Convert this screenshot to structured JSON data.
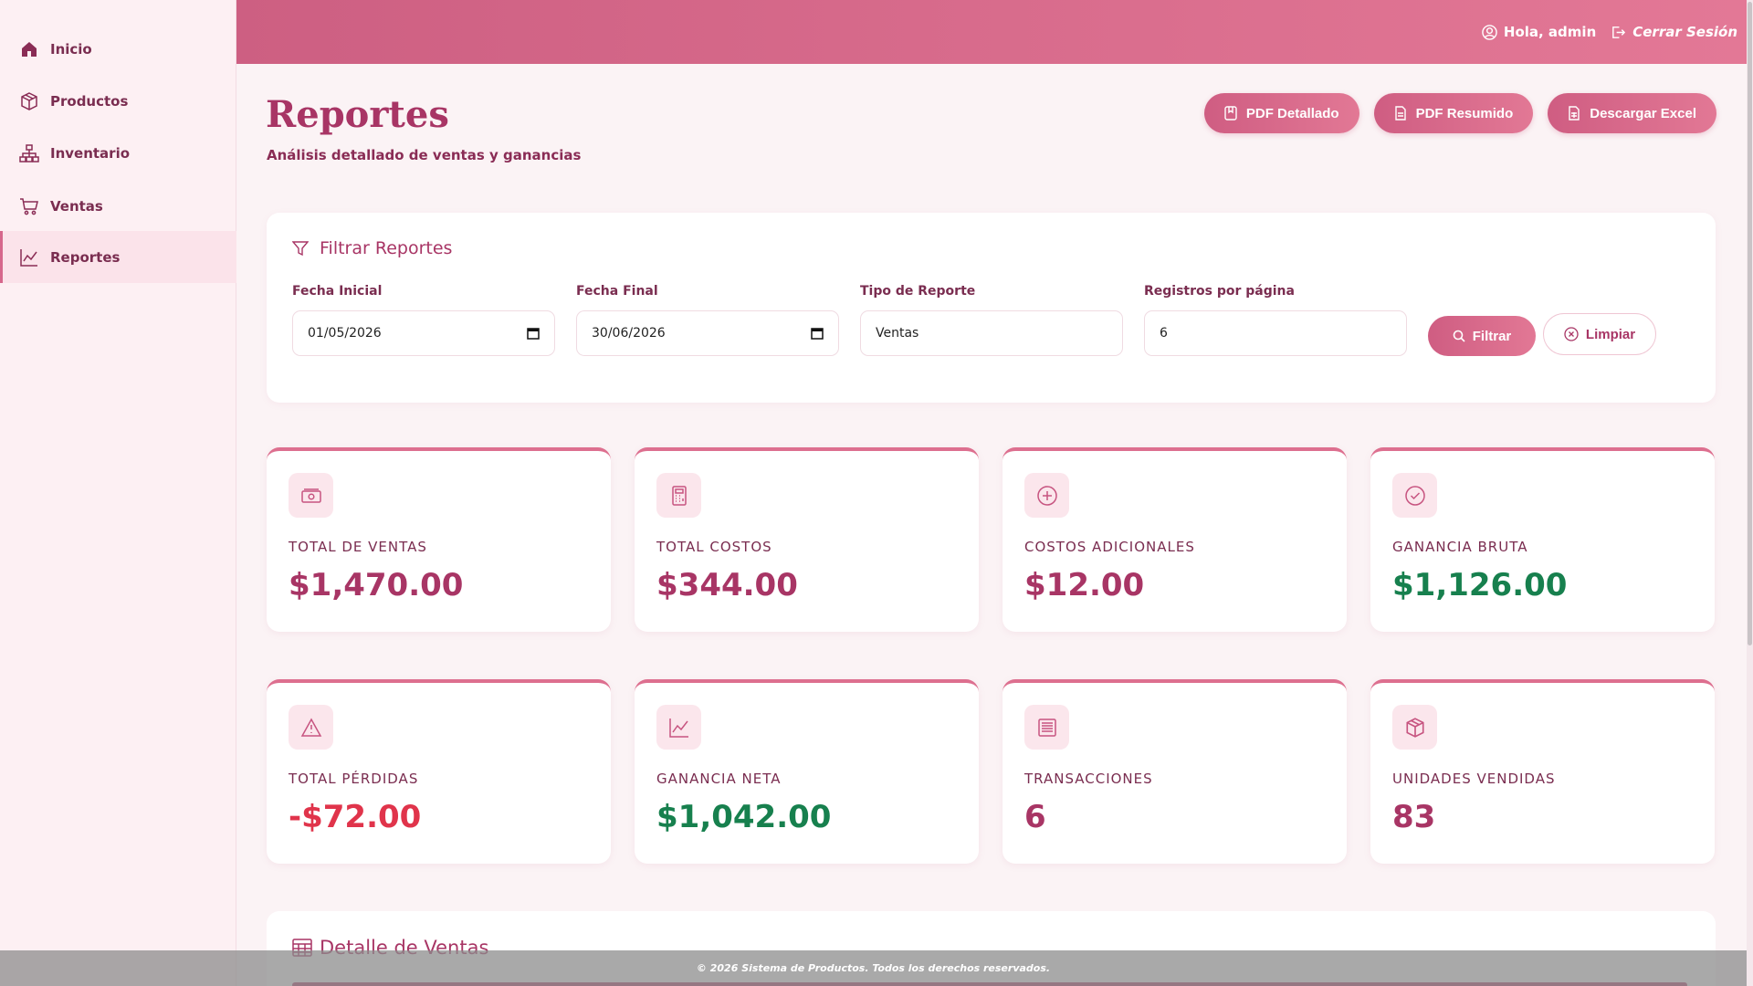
{
  "colors": {
    "accent": "#d6678c",
    "primary_text": "#a83565",
    "positive": "#17804e",
    "negative": "#e0344b"
  },
  "sidebar": {
    "items": [
      {
        "label": "Inicio",
        "icon": "home-icon"
      },
      {
        "label": "Productos",
        "icon": "box-icon"
      },
      {
        "label": "Inventario",
        "icon": "hierarchy-icon"
      },
      {
        "label": "Ventas",
        "icon": "cart-icon"
      },
      {
        "label": "Reportes",
        "icon": "chart-line-icon",
        "active": true
      }
    ]
  },
  "header": {
    "greeting": "Hola, admin",
    "logout": "Cerrar Sesión"
  },
  "page": {
    "title": "Reportes",
    "subtitle": "Análisis detallado de ventas y ganancias"
  },
  "actions": {
    "pdf_detailed": "PDF Detallado",
    "pdf_summary": "PDF Resumido",
    "excel": "Descargar Excel"
  },
  "filter": {
    "title": "Filtrar Reportes",
    "start_label": "Fecha Inicial",
    "start_value": "01/05/2026",
    "end_label": "Fecha Final",
    "end_value": "30/06/2026",
    "type_label": "Tipo de Reporte",
    "type_value": "Ventas",
    "per_page_label": "Registros por página",
    "per_page_value": "6",
    "filter_button": "Filtrar",
    "clear_button": "Limpiar"
  },
  "stats": [
    {
      "label": "TOTAL DE VENTAS",
      "value": "$1,470.00",
      "icon": "cash-icon"
    },
    {
      "label": "TOTAL COSTOS",
      "value": "$344.00",
      "icon": "calculator-icon"
    },
    {
      "label": "COSTOS ADICIONALES",
      "value": "$12.00",
      "icon": "plus-circle-icon"
    },
    {
      "label": "GANANCIA BRUTA",
      "value": "$1,126.00",
      "icon": "check-circle-icon"
    },
    {
      "label": "TOTAL PÉRDIDAS",
      "value": "-$72.00",
      "icon": "warning-icon"
    },
    {
      "label": "GANANCIA NETA",
      "value": "$1,042.00",
      "icon": "graph-icon"
    },
    {
      "label": "TRANSACCIONES",
      "value": "6",
      "icon": "receipt-icon"
    },
    {
      "label": "UNIDADES VENDIDAS",
      "value": "83",
      "icon": "box-icon"
    }
  ],
  "detail": {
    "title": "Detalle de Ventas"
  },
  "footer": {
    "text": "© 2026 Sistema de Productos. Todos los derechos reservados."
  }
}
